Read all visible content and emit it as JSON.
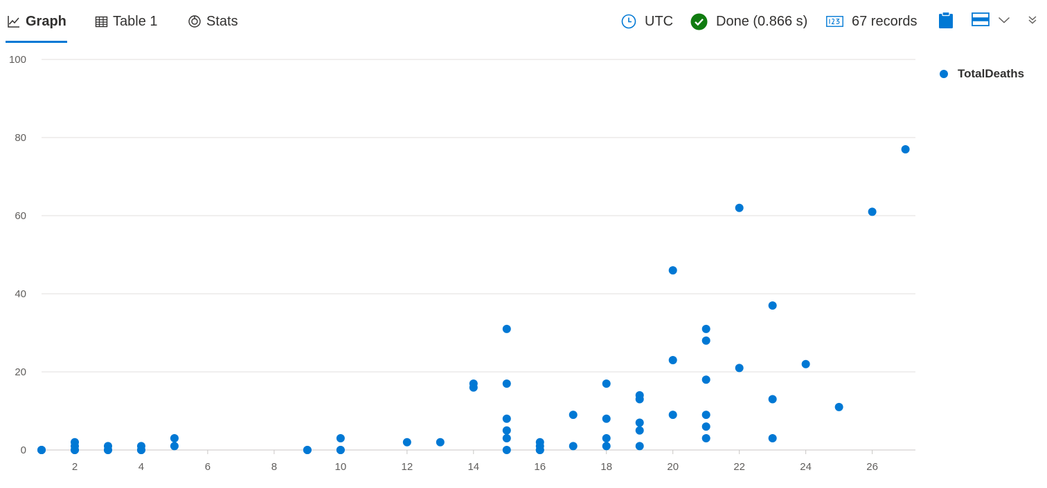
{
  "tabs": [
    {
      "label": "Graph",
      "icon": "line-chart-icon",
      "active": true
    },
    {
      "label": "Table 1",
      "icon": "table-icon",
      "active": false
    },
    {
      "label": "Stats",
      "icon": "stats-icon",
      "active": false
    }
  ],
  "status": {
    "timezone": "UTC",
    "timezone_icon": "clock-icon",
    "done": "Done (0.866 s)",
    "done_icon": "check-circle-icon",
    "records": "67 records",
    "records_icon": "number-icon"
  },
  "toolbar_icons": [
    "clipboard-icon",
    "card-layout-icon",
    "chevron-down-icon",
    "double-chevron-down-icon"
  ],
  "colors": {
    "accent": "#0078d4",
    "success": "#107c10",
    "gridline": "#e1dfdd",
    "axis_text": "#605e5c"
  },
  "chart_data": {
    "type": "scatter",
    "title": "",
    "xlabel": "",
    "ylabel": "",
    "xlim": [
      1,
      27.3
    ],
    "ylim": [
      0,
      100
    ],
    "x_ticks": [
      "2",
      "4",
      "6",
      "8",
      "10",
      "12",
      "14",
      "16",
      "18",
      "20",
      "22",
      "24",
      "26"
    ],
    "y_ticks": [
      "0",
      "20",
      "40",
      "60",
      "80",
      "100"
    ],
    "grid": true,
    "legend_position": "top-right",
    "series": [
      {
        "name": "TotalDeaths",
        "color": "#0078d4",
        "points": [
          [
            1,
            0
          ],
          [
            1,
            0
          ],
          [
            1,
            0
          ],
          [
            2,
            2
          ],
          [
            2,
            1
          ],
          [
            2,
            0
          ],
          [
            2,
            0
          ],
          [
            3,
            1
          ],
          [
            3,
            0
          ],
          [
            3,
            0
          ],
          [
            4,
            1
          ],
          [
            4,
            0
          ],
          [
            4,
            0
          ],
          [
            5,
            3
          ],
          [
            5,
            1
          ],
          [
            9,
            0
          ],
          [
            9,
            0
          ],
          [
            10,
            3
          ],
          [
            10,
            0
          ],
          [
            10,
            0
          ],
          [
            12,
            2
          ],
          [
            13,
            2
          ],
          [
            14,
            17
          ],
          [
            14,
            16
          ],
          [
            15,
            31
          ],
          [
            15,
            17
          ],
          [
            15,
            8
          ],
          [
            15,
            5
          ],
          [
            15,
            3
          ],
          [
            15,
            0
          ],
          [
            16,
            2
          ],
          [
            16,
            1
          ],
          [
            16,
            0
          ],
          [
            16,
            0
          ],
          [
            17,
            9
          ],
          [
            17,
            1
          ],
          [
            18,
            17
          ],
          [
            18,
            8
          ],
          [
            18,
            3
          ],
          [
            18,
            1
          ],
          [
            19,
            14
          ],
          [
            19,
            13
          ],
          [
            19,
            7
          ],
          [
            19,
            5
          ],
          [
            19,
            1
          ],
          [
            20,
            46
          ],
          [
            20,
            23
          ],
          [
            20,
            9
          ],
          [
            21,
            31
          ],
          [
            21,
            28
          ],
          [
            21,
            18
          ],
          [
            21,
            9
          ],
          [
            21,
            6
          ],
          [
            21,
            3
          ],
          [
            22,
            62
          ],
          [
            22,
            21
          ],
          [
            23,
            37
          ],
          [
            23,
            13
          ],
          [
            23,
            3
          ],
          [
            24,
            22
          ],
          [
            25,
            11
          ],
          [
            26,
            61
          ],
          [
            27,
            77
          ]
        ]
      }
    ]
  }
}
